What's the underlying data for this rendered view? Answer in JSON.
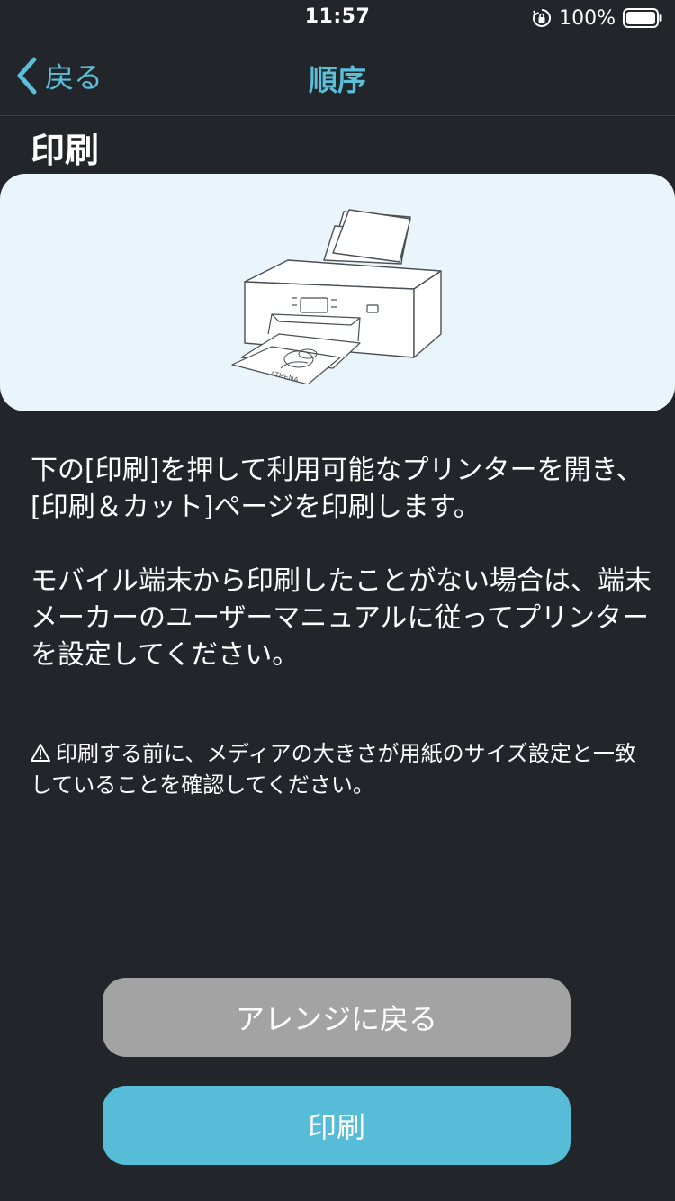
{
  "status_bar": {
    "time": "11:57",
    "battery_percent": "100%",
    "icons": [
      "orientation-lock-icon",
      "battery-icon"
    ]
  },
  "nav": {
    "back_label": "戻る",
    "title": "順序",
    "back_icon": "chevron-left-icon"
  },
  "section_title": "印刷",
  "illustration": {
    "icon": "printer-icon",
    "paper_text": "ATHENA"
  },
  "instructions": {
    "p1": "下の[印刷]を押して利用可能なプリンターを開き、[印刷＆カット]ページを印刷します。",
    "p2": "モバイル端末から印刷したことがない場合は、端末メーカーのユーザーマニュアルに従ってプリンターを設定してください。"
  },
  "warning": {
    "icon": "warning-icon",
    "text": "印刷する前に、メディアの大きさが用紙のサイズ設定と一致していることを確認してください。"
  },
  "buttons": {
    "arrange_label": "アレンジに戻る",
    "print_label": "印刷"
  },
  "colors": {
    "background": "#22262b",
    "accent": "#5bbfd8",
    "card": "#e9f5fa",
    "button_secondary": "#a3a3a3",
    "button_primary": "#57bcd8"
  }
}
